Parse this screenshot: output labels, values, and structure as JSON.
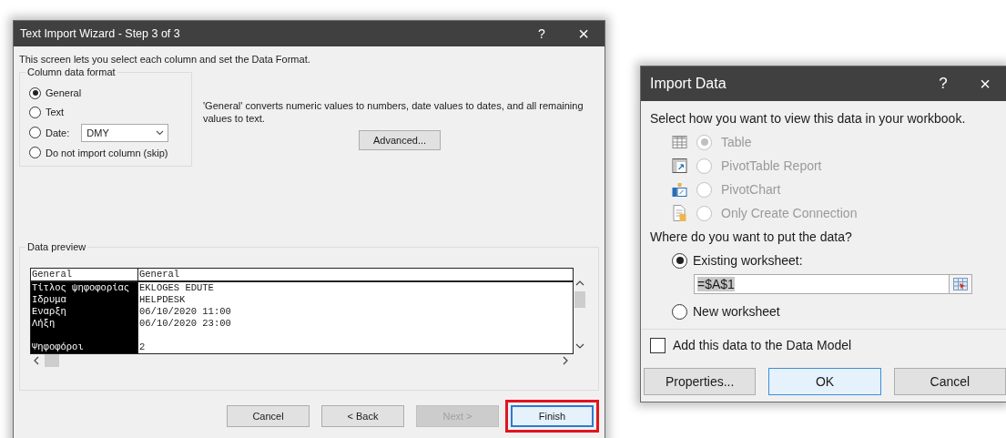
{
  "wizard": {
    "title": "Text Import Wizard - Step 3 of 3",
    "help": "?",
    "close": "×",
    "intro": "This screen lets you select each column and set the Data Format.",
    "column_format": {
      "legend": "Column data format",
      "options": [
        {
          "label": "General",
          "selected": true
        },
        {
          "label": "Text",
          "selected": false
        },
        {
          "label": "Date:",
          "selected": false,
          "select_value": "DMY"
        },
        {
          "label": "Do not import column (skip)",
          "selected": false
        }
      ]
    },
    "description": "'General' converts numeric values to numbers, date values to dates, and all remaining values to text.",
    "advanced_button": "Advanced...",
    "preview": {
      "legend": "Data preview",
      "columns": [
        {
          "label": "General",
          "selected": true
        },
        {
          "label": "General",
          "selected": false
        }
      ],
      "rows": [
        {
          "cells": [
            "Τίτλος ψηφοφορίας",
            "EKLOGES EDUTE"
          ],
          "spaced": false
        },
        {
          "cells": [
            "Ιδρυμα",
            "HELPDESK"
          ],
          "spaced": false
        },
        {
          "cells": [
            "Εναρξη",
            "06/10/2020 11:00"
          ],
          "spaced": false
        },
        {
          "cells": [
            "Λήξη",
            "06/10/2020 23:00"
          ],
          "spaced": false
        },
        {
          "cells": [
            "Ψηφοφόροι",
            "2"
          ],
          "spaced": true
        }
      ]
    },
    "buttons": [
      {
        "label": "Cancel",
        "disabled": false,
        "highlighted": false
      },
      {
        "label": "< Back",
        "disabled": false,
        "highlighted": false
      },
      {
        "label": "Next >",
        "disabled": true,
        "highlighted": false
      },
      {
        "label": "Finish",
        "disabled": false,
        "highlighted": true
      }
    ]
  },
  "import_data": {
    "title": "Import Data",
    "help": "?",
    "close": "×",
    "prompt": "Select how you want to view this data in your workbook.",
    "view_options": [
      {
        "label": "Table",
        "kind": "table",
        "selected": true,
        "disabled": true
      },
      {
        "label": "PivotTable Report",
        "kind": "pivot-table",
        "selected": false,
        "disabled": true
      },
      {
        "label": "PivotChart",
        "kind": "pivot-chart",
        "selected": false,
        "disabled": true
      },
      {
        "label": "Only Create Connection",
        "kind": "connection",
        "selected": false,
        "disabled": true
      }
    ],
    "location_prompt": "Where do you want to put the data?",
    "location_options": [
      {
        "label": "Existing worksheet:",
        "selected": true,
        "field_value": "=$A$1"
      },
      {
        "label": "New worksheet",
        "selected": false
      }
    ],
    "data_model": {
      "label": "Add this data to the Data Model",
      "checked": false
    },
    "buttons": [
      {
        "label": "Properties...",
        "default": false
      },
      {
        "label": "OK",
        "default": true
      },
      {
        "label": "Cancel",
        "default": false
      }
    ]
  }
}
